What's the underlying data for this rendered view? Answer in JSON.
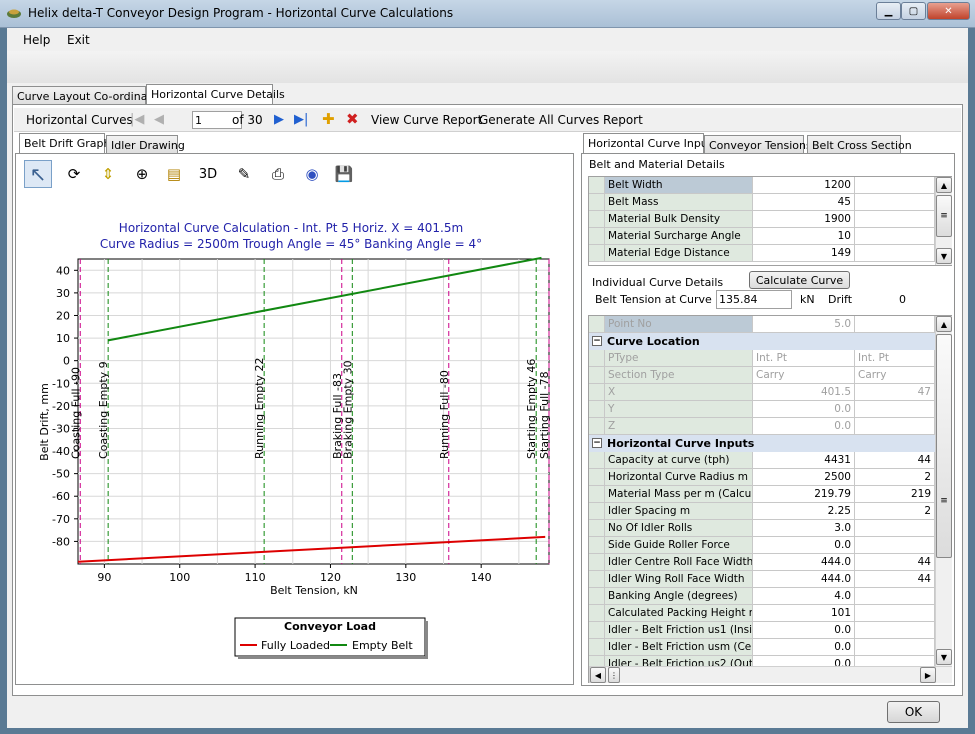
{
  "window": {
    "title": "Helix delta-T Conveyor Design Program - Horizontal Curve Calculations"
  },
  "menu": {
    "help": "Help",
    "exit": "Exit"
  },
  "main_tabs": {
    "layout": "Curve Layout Co-ordinates",
    "details": "Horizontal Curve Details"
  },
  "nav": {
    "label": "Horizontal Curves",
    "current": "1",
    "of": "of 30",
    "view_report": "View Curve Report",
    "generate_all": "Generate All Curves Report"
  },
  "left_tabs": {
    "graphs": "Belt Drift Graphs",
    "idler": "Idler Drawing"
  },
  "graph_toolbar": {
    "three_d": "3D"
  },
  "chart_data": {
    "type": "line",
    "title": "Horizontal Curve Calculation - Int. Pt 5 Horiz. X = 401.5m",
    "subtitle": "Curve Radius = 2500m Trough Angle = 45° Banking Angle = 4°",
    "xlabel": "Belt Tension, kN",
    "ylabel": "Belt Drift, mm",
    "xlim": [
      86.5,
      149
    ],
    "ylim": [
      -90,
      45
    ],
    "x_ticks": [
      90,
      100,
      110,
      120,
      130,
      140
    ],
    "y_ticks": [
      40,
      30,
      20,
      10,
      0,
      -10,
      -20,
      -30,
      -40,
      -50,
      -60,
      -70,
      -80
    ],
    "grid": true,
    "legend_title": "Conveyor Load",
    "legend_position": "bottom-center",
    "series": [
      {
        "name": "Fully Loaded",
        "color": "#dd0000",
        "x": [
          86.5,
          148.5
        ],
        "y": [
          -89,
          -78
        ]
      },
      {
        "name": "Empty Belt",
        "color": "#118811",
        "x": [
          90.5,
          148
        ],
        "y": [
          9,
          45.5
        ]
      }
    ],
    "markers": [
      {
        "x": 86.8,
        "label": "Coasting Full -90",
        "color": "#cc0088"
      },
      {
        "x": 90.5,
        "label": "Coasting Empty 9",
        "color": "#118811"
      },
      {
        "x": 111.2,
        "label": "Running Empty 22",
        "color": "#118811"
      },
      {
        "x": 121.5,
        "label": "Braking Full -83",
        "color": "#cc0088"
      },
      {
        "x": 122.9,
        "label": "Braking Empty 30",
        "color": "#118811"
      },
      {
        "x": 135.7,
        "label": "Running Full -80",
        "color": "#cc0088"
      },
      {
        "x": 147.3,
        "label": "Starting Empty 46",
        "color": "#118811"
      },
      {
        "x": 149,
        "label": "Starting Full -78",
        "color": "#cc0088"
      }
    ]
  },
  "right_tabs": {
    "inputs": "Horizontal Curve Inputs",
    "tensions": "Conveyor Tensions",
    "cross": "Belt Cross Section"
  },
  "belt": {
    "heading": "Belt and Material Details",
    "rows": [
      {
        "label": "Belt Width",
        "value": "1200"
      },
      {
        "label": "Belt Mass",
        "value": "45"
      },
      {
        "label": "Material Bulk Density",
        "value": "1900"
      },
      {
        "label": "Material Surcharge Angle",
        "value": "10"
      },
      {
        "label": "Material Edge Distance",
        "value": "149"
      }
    ]
  },
  "individual": {
    "heading": "Individual Curve Details",
    "calc_btn": "Calculate Curve",
    "tension_label": "Belt Tension at Curve",
    "tension_value": "135.84",
    "unit": "kN",
    "drift_label": "Drift",
    "drift_value": "0"
  },
  "detail": {
    "point_no": {
      "label": "Point No",
      "value": "5.0"
    },
    "cat1": "Curve Location",
    "loc_rows": [
      {
        "label": "PType",
        "v1": "Int. Pt",
        "v2": "Int. Pt"
      },
      {
        "label": "Section Type",
        "v1": "Carry",
        "v2": "Carry"
      },
      {
        "label": "X",
        "v1": "401.5",
        "v2": "47"
      },
      {
        "label": "Y",
        "v1": "0.0",
        "v2": ""
      },
      {
        "label": "Z",
        "v1": "0.0",
        "v2": ""
      }
    ],
    "cat2": "Horizontal Curve Inputs",
    "inp_rows": [
      {
        "label": "Capacity at curve (tph)",
        "v1": "4431",
        "v2": "44"
      },
      {
        "label": "Horizontal Curve Radius m",
        "v1": "2500",
        "v2": "2"
      },
      {
        "label": "Material Mass per m (Calcul",
        "v1": "219.79",
        "v2": "219"
      },
      {
        "label": "Idler Spacing m",
        "v1": "2.25",
        "v2": "2"
      },
      {
        "label": "No Of Idler Rolls",
        "v1": "3.0",
        "v2": ""
      },
      {
        "label": "Side Guide Roller Force",
        "v1": "0.0",
        "v2": ""
      },
      {
        "label": "Idler Centre Roll Face Width",
        "v1": "444.0",
        "v2": "44"
      },
      {
        "label": "Idler Wing Roll Face Width",
        "v1": "444.0",
        "v2": "44"
      },
      {
        "label": "Banking Angle (degrees)",
        "v1": "4.0",
        "v2": ""
      },
      {
        "label": "Calculated Packing Height m",
        "v1": "101",
        "v2": ""
      },
      {
        "label": "Idler - Belt Friction us1 (Insi",
        "v1": "0.0",
        "v2": ""
      },
      {
        "label": "Idler - Belt Friction usm (Cen",
        "v1": "0.0",
        "v2": ""
      },
      {
        "label": "Idler - Belt Friction us2 (Out",
        "v1": "0.0",
        "v2": ""
      }
    ]
  },
  "ok": "OK"
}
